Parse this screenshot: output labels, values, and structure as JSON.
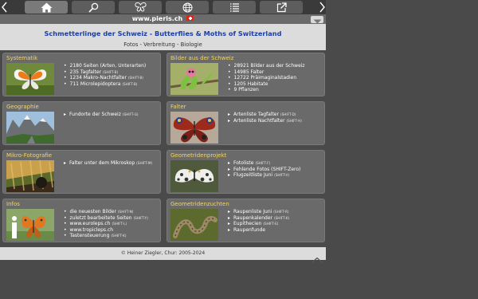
{
  "site": {
    "domain": "www.pieris.ch",
    "flag": "swiss-flag"
  },
  "header": {
    "title": "Schmetterlinge der Schweiz - Butterflies & Moths of Switzerland",
    "subtitle": "Fotos - Verbreitung - Biologie"
  },
  "toolbar": [
    "home-icon",
    "search-icon",
    "butterfly-icon",
    "globe-icon",
    "list-icon",
    "open-external-icon"
  ],
  "panels": {
    "systematik": {
      "title": "Systematik",
      "items": [
        {
          "text": "2180 Seiten (Arten, Unterarten)",
          "key": ""
        },
        {
          "text": "235 Tagfalter",
          "key": "(SHIFT-B)"
        },
        {
          "text": "1234 Makro-Nachtfalter",
          "key": "(SHIFT-B)"
        },
        {
          "text": "711 Microlepidoptera",
          "key": "(SHIFT-B)"
        }
      ]
    },
    "bilder": {
      "title": "Bilder aus der Schweiz",
      "items": [
        {
          "text": "28921 Bilder aus der Schweiz",
          "key": ""
        },
        {
          "text": "14985 Falter",
          "key": ""
        },
        {
          "text": "12722 Präimaginalstadien",
          "key": ""
        },
        {
          "text": "1205 Habitate",
          "key": ""
        },
        {
          "text": "9 Pflanzen",
          "key": ""
        }
      ]
    },
    "geographie": {
      "title": "Geographie",
      "items": [
        {
          "text": "Fundorte der Schweiz",
          "key": "(SHIFT-G)"
        }
      ]
    },
    "falter": {
      "title": "Falter",
      "items": [
        {
          "text": "Artenliste Tagfalter",
          "key": "(SHIFT-D)"
        },
        {
          "text": "Artenliste Nachtfalter",
          "key": "(SHIFT-H)"
        }
      ]
    },
    "mikro": {
      "title": "Mikro-Fotografie",
      "items": [
        {
          "text": "Falter unter dem Mikroskop",
          "key": "(SHIFT-M)"
        }
      ]
    },
    "geometridenprojekt": {
      "title": "Geometridenprojekt",
      "items": [
        {
          "text": "Fotoliste",
          "key": "(SHIFT-F)"
        },
        {
          "text": "Fehlende Fotos (SHIFT-Zero)",
          "key": ""
        },
        {
          "text": "Flugzeitliste Juni",
          "key": "(SHIFT-V)"
        }
      ]
    },
    "infos": {
      "title": "Infos",
      "items": [
        {
          "text": "die neuesten Bilder",
          "key": "(SHIFT-N)"
        },
        {
          "text": "zuletzt bearbeitete Seiten",
          "key": "(SHIFT-Y)"
        },
        {
          "text": "www.euroleps.ch",
          "key": "(SHIFT-L)"
        },
        {
          "text": "www.tropicleps.ch",
          "key": ""
        },
        {
          "text": "Tastensteuerung",
          "key": "(SHIFT-K)"
        }
      ]
    },
    "geometridenzuchten": {
      "title": "Geometridenzuchten",
      "items": [
        {
          "text": "Raupenliste Juni",
          "key": "(SHIFT-R)"
        },
        {
          "text": "Raupenkalender",
          "key": "(SHIFT-K)"
        },
        {
          "text": "Eupithecien",
          "key": "(SHIFT-E)"
        },
        {
          "text": "Raupenfunde",
          "key": ""
        }
      ]
    }
  },
  "footer": {
    "text": "© Heiner Ziegler, Chur: 2005-2024"
  }
}
